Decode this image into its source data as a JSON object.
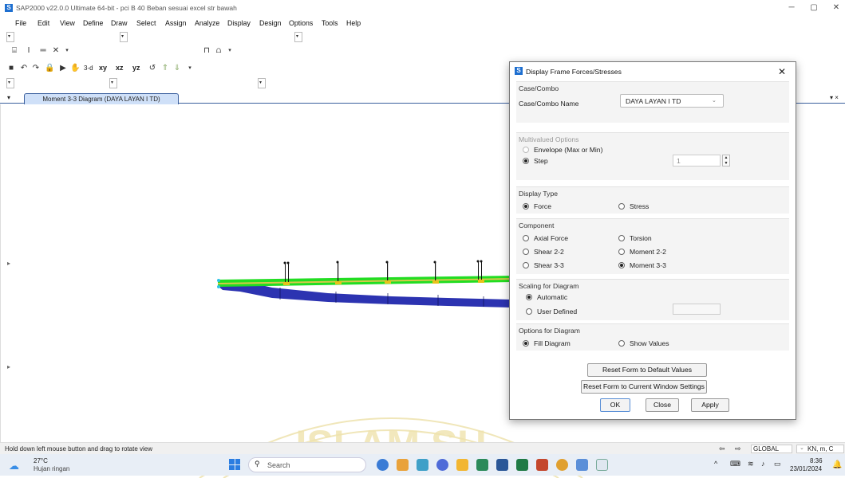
{
  "titlebar": {
    "title": "SAP2000 v22.0.0 Ultimate 64-bit - pci B 40 Beban sesuai excel str bawah",
    "app_icon_letter": "S",
    "minimize_glyph": "─",
    "restore_glyph": "▢",
    "close_glyph": "✕"
  },
  "menu": [
    "File",
    "Edit",
    "View",
    "Define",
    "Draw",
    "Select",
    "Assign",
    "Analyze",
    "Display",
    "Design",
    "Options",
    "Tools",
    "Help"
  ],
  "toolbar": {
    "view_3d": "3-d",
    "view_xy": "xy",
    "view_xz": "xz",
    "view_yz": "yz"
  },
  "tab": {
    "label": "Moment 3-3 Diagram (DAYA LAYAN I TD)",
    "right_glyph": "▾ ×"
  },
  "dialog": {
    "icon_letter": "S",
    "title": "Display Frame Forces/Stresses",
    "close_glyph": "✕",
    "case_combo": {
      "group_title": "Case/Combo",
      "name_label": "Case/Combo Name",
      "selected": "DAYA LAYAN I TD"
    },
    "multivalued": {
      "group_title": "Multivalued Options",
      "envelope_label": "Envelope (Max or Min)",
      "step_label": "Step",
      "step_value": "1"
    },
    "display_type": {
      "group_title": "Display Type",
      "force_label": "Force",
      "stress_label": "Stress"
    },
    "component": {
      "group_title": "Component",
      "axial": "Axial Force",
      "torsion": "Torsion",
      "shear22": "Shear 2-2",
      "moment22": "Moment 2-2",
      "shear33": "Shear 3-3",
      "moment33": "Moment 3-3"
    },
    "scaling": {
      "group_title": "Scaling for Diagram",
      "automatic": "Automatic",
      "user_defined": "User Defined"
    },
    "options": {
      "group_title": "Options for Diagram",
      "fill": "Fill Diagram",
      "show_values": "Show Values"
    },
    "buttons": {
      "reset_default": "Reset Form to Default Values",
      "reset_current": "Reset Form to Current Window Settings",
      "ok": "OK",
      "close": "Close",
      "apply": "Apply"
    }
  },
  "statusbar": {
    "hint": "Hold down left mouse button and drag to rotate view",
    "coord_system": "GLOBAL",
    "units": "KN, m, C"
  },
  "watermark": {
    "text": "ISLAM SU"
  },
  "taskbar": {
    "temperature": "27°C",
    "weather": "Hujan ringan",
    "search_placeholder": "Search",
    "time": "8:36",
    "date": "23/01/2024"
  },
  "colors": {
    "diagram_top": "#22dd22",
    "diagram_bottom": "#1a22aa",
    "tab_border": "#3a5f9e",
    "app_icon": "#1e6fd0"
  }
}
